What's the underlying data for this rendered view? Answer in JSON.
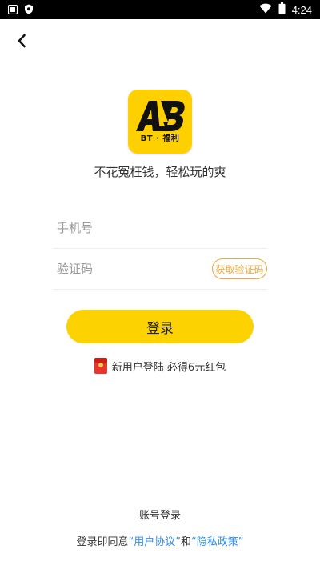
{
  "status_bar": {
    "time": "4:24",
    "left_icons": [
      "notification-square-icon",
      "shield-icon"
    ],
    "right_icons": [
      "wifi-icon",
      "battery-icon"
    ]
  },
  "header": {
    "back_icon": "chevron-left-icon"
  },
  "logo": {
    "letters": "AB",
    "tagline": "BT · 福利",
    "background_color": "#ffd000"
  },
  "slogan": "不花冤枉钱，轻松玩的爽",
  "form": {
    "phone_placeholder": "手机号",
    "code_placeholder": "验证码",
    "get_code_label": "获取验证码",
    "accent_color": "#f0a63a"
  },
  "login_button": {
    "label": "登录",
    "color": "#fcd200"
  },
  "promo": {
    "icon": "red-packet-icon",
    "text": "新用户登陆 必得6元红包"
  },
  "footer": {
    "account_login": "账号登录",
    "agreement_prefix": "登录即同意",
    "user_agreement": "“用户协议”",
    "and": "和",
    "privacy_policy": "“隐私政策”",
    "link_color": "#2d8cf0"
  }
}
